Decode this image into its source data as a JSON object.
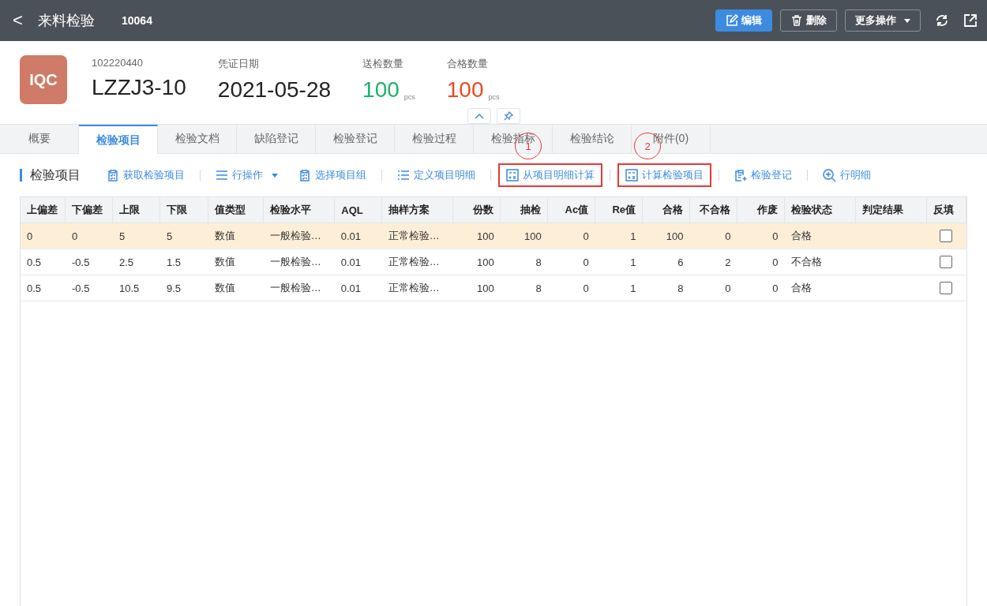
{
  "header": {
    "back": "<",
    "title": "来料检验",
    "doc_no": "10064",
    "actions": [
      {
        "label": "编辑",
        "kind": "primary"
      },
      {
        "label": "删除",
        "kind": "outline"
      },
      {
        "label": "更多操作",
        "kind": "dropdown"
      }
    ]
  },
  "summary": {
    "badge": "IQC",
    "fields": [
      {
        "label": "102220440",
        "value": "LZZJ3-10",
        "kind": "plain"
      },
      {
        "label": "凭证日期",
        "value": "2021-05-28",
        "kind": "plain"
      },
      {
        "label": "送检数量",
        "value": "100",
        "unit": "pcs",
        "kind": "good"
      },
      {
        "label": "合格数量",
        "value": "100",
        "unit": "pcs",
        "kind": "bad"
      }
    ]
  },
  "tabs": [
    {
      "label": "概要",
      "selected": false
    },
    {
      "label": "检验项目",
      "selected": true
    },
    {
      "label": "检验文档",
      "selected": false
    },
    {
      "label": "缺陷登记",
      "selected": false
    },
    {
      "label": "检验登记",
      "selected": false
    },
    {
      "label": "检验过程",
      "selected": false
    },
    {
      "label": "检验指标",
      "selected": false
    },
    {
      "label": "检验结论",
      "selected": false
    },
    {
      "label": "附件(0)",
      "selected": false
    }
  ],
  "section_title": "检验项目",
  "toolbar": [
    {
      "label": "获取检验项目",
      "dropdown": false,
      "highlighted": false
    },
    {
      "label": "行操作",
      "dropdown": true,
      "highlighted": false
    },
    {
      "label": "选择项目组",
      "dropdown": false,
      "highlighted": false
    },
    {
      "label": "定义项目明细",
      "dropdown": false,
      "highlighted": false
    },
    {
      "label": "从项目明细计算",
      "dropdown": false,
      "highlighted": true,
      "callout": "1"
    },
    {
      "label": "计算检验项目",
      "dropdown": false,
      "highlighted": true,
      "callout": "2"
    },
    {
      "label": "检验登记",
      "dropdown": false,
      "highlighted": false
    },
    {
      "label": "行明细",
      "dropdown": false,
      "highlighted": false
    }
  ],
  "table": {
    "columns": [
      "上偏差",
      "下偏差",
      "上限",
      "下限",
      "值类型",
      "检验水平",
      "AQL",
      "抽样方案",
      "份数",
      "抽检",
      "Ac值",
      "Re值",
      "合格",
      "不合格",
      "作废",
      "检验状态",
      "判定结果",
      "反填"
    ],
    "rows": [
      {
        "selected": true,
        "checked": false,
        "cells": [
          "0",
          "0",
          "5",
          "5",
          "数值",
          "一般检验…",
          "0.01",
          "正常检验…",
          "100",
          "100",
          "0",
          "1",
          "100",
          "0",
          "0",
          "合格",
          ""
        ]
      },
      {
        "selected": false,
        "checked": false,
        "cells": [
          "0.5",
          "-0.5",
          "2.5",
          "1.5",
          "数值",
          "一般检验…",
          "0.01",
          "正常检验…",
          "100",
          "8",
          "0",
          "1",
          "6",
          "2",
          "0",
          "不合格",
          ""
        ]
      },
      {
        "selected": false,
        "checked": false,
        "cells": [
          "0.5",
          "-0.5",
          "10.5",
          "9.5",
          "数值",
          "一般检验…",
          "0.01",
          "正常检验…",
          "100",
          "8",
          "0",
          "1",
          "8",
          "0",
          "0",
          "合格",
          ""
        ]
      }
    ]
  }
}
